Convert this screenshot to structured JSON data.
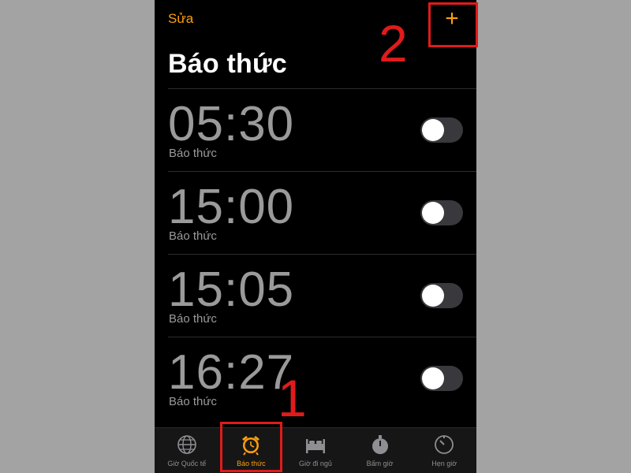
{
  "header": {
    "edit_label": "Sửa",
    "add_symbol": "+",
    "title": "Báo thức"
  },
  "alarms": [
    {
      "time": "05:30",
      "label": "Báo thức",
      "enabled": false
    },
    {
      "time": "15:00",
      "label": "Báo thức",
      "enabled": false
    },
    {
      "time": "15:05",
      "label": "Báo thức",
      "enabled": false
    },
    {
      "time": "16:27",
      "label": "Báo thức",
      "enabled": false
    }
  ],
  "tabs": [
    {
      "label": "Giờ Quốc tế",
      "icon": "globe-icon",
      "active": false
    },
    {
      "label": "Báo thức",
      "icon": "alarm-clock-icon",
      "active": true
    },
    {
      "label": "Giờ đi ngủ",
      "icon": "bed-icon",
      "active": false
    },
    {
      "label": "Bấm giờ",
      "icon": "stopwatch-icon",
      "active": false
    },
    {
      "label": "Hẹn giờ",
      "icon": "timer-icon",
      "active": false
    }
  ],
  "annotations": [
    {
      "number": "1",
      "target": "alarm tab"
    },
    {
      "number": "2",
      "target": "add button"
    }
  ],
  "colors": {
    "accent": "#ff9f0a",
    "annotation": "#e01b1b",
    "toggle_off": "#39393d"
  }
}
